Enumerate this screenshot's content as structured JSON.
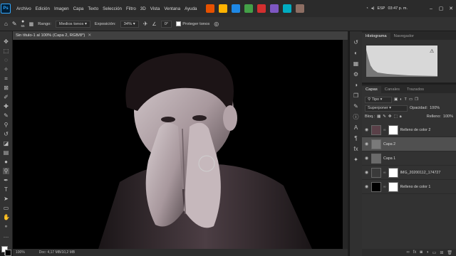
{
  "menu": [
    "Archivo",
    "Edición",
    "Imagen",
    "Capa",
    "Texto",
    "Selección",
    "Filtro",
    "3D",
    "Vista",
    "Ventana",
    "Ayuda"
  ],
  "app_badge": "Ps",
  "taskbar": {
    "lang": "ESP",
    "time": "03:47 p. m.",
    "date": "",
    "colors": [
      "#e65100",
      "#ffb300",
      "#1e88e5",
      "#43a047",
      "#d32f2f",
      "#7e57c2",
      "#00acc1",
      "#8d6e63"
    ]
  },
  "options": {
    "range_label": "Rango:",
    "range_value": "Medios tonos",
    "exposure_label": "Exposición:",
    "exposure_value": "34%",
    "angle_value": "0°",
    "protect_label": "Proteger tonos",
    "brush_size": "65"
  },
  "document": {
    "tab_title": "Sin título-1 al 100% (Capa 2, RGB/8*)",
    "zoom": "100%",
    "doc_info": "Doc: 4,17 MB/10,2 MB"
  },
  "panels": {
    "top_tabs": [
      "Histograma",
      "Navegador"
    ],
    "layer_tabs": [
      "Capas",
      "Canales",
      "Trazados"
    ],
    "kind": "Tipo",
    "blend": "Superponer",
    "opacity_label": "Opacidad:",
    "opacity": "100%",
    "lock_label": "Bloq.:",
    "fill_label": "Relleno:",
    "fill": "100%"
  },
  "layers": [
    {
      "name": "Relleno de color 2",
      "selected": false,
      "thumb": "#5a4048",
      "mask": true
    },
    {
      "name": "Capa 2",
      "selected": true,
      "thumb": "#7a7a7a",
      "mask": false
    },
    {
      "name": "Capa 1",
      "selected": false,
      "thumb": "#6a6a6a",
      "mask": false
    },
    {
      "name": "IMG_20200112_174727",
      "selected": false,
      "thumb": "#3a3a3a",
      "mask": true
    },
    {
      "name": "Relleno de color 1",
      "selected": false,
      "thumb": "#000000",
      "mask": true
    }
  ]
}
